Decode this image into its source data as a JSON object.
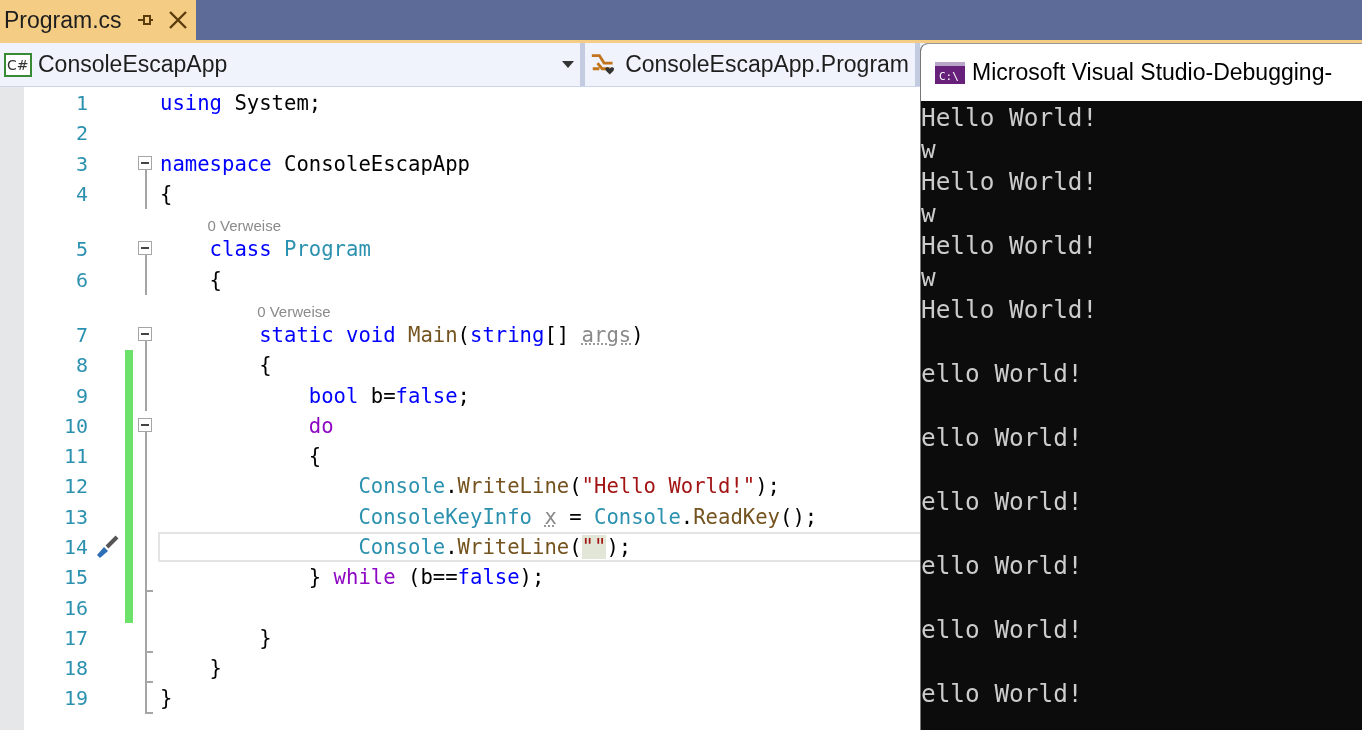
{
  "tab": {
    "title": "Program.cs",
    "active": true
  },
  "navbar": {
    "icon_label": "C#",
    "project": "ConsoleEscapApp",
    "type": "ConsoleEscapApp.Program"
  },
  "editor": {
    "lines": [
      {
        "number": "1",
        "collapsible": false,
        "in_block": false,
        "block_end": false,
        "changed": false,
        "current": false,
        "tokens": [
          {
            "text": "using ",
            "kind": "kw"
          },
          {
            "text": "System;",
            "kind": "plain"
          }
        ]
      },
      {
        "number": "2",
        "collapsible": false,
        "in_block": false,
        "block_end": false,
        "changed": false,
        "current": false
      },
      {
        "number": "3",
        "collapsible": true,
        "in_block": true,
        "block_end": false,
        "changed": false,
        "current": false,
        "tokens": [
          {
            "text": "namespace ",
            "kind": "kw"
          },
          {
            "text": "ConsoleEscapApp",
            "kind": "plain"
          }
        ]
      },
      {
        "number": "4",
        "collapsible": false,
        "in_block": true,
        "block_end": false,
        "changed": false,
        "current": false,
        "tokens": [
          {
            "text": "{",
            "kind": "plain"
          }
        ],
        "children": [
          {
            "number": "5",
            "collapsible": true,
            "in_block": true,
            "block_end": false,
            "changed": false,
            "current": false,
            "codelens": "0 Verweise",
            "tokens": [
              {
                "text": "class ",
                "kind": "kw"
              },
              {
                "text": "Program",
                "kind": "type"
              }
            ]
          },
          {
            "number": "6",
            "collapsible": false,
            "in_block": true,
            "block_end": false,
            "changed": false,
            "current": false,
            "tokens": [
              {
                "text": "{",
                "kind": "plain"
              }
            ],
            "children": [
              {
                "number": "7",
                "collapsible": true,
                "in_block": true,
                "block_end": false,
                "changed": false,
                "current": false,
                "codelens": "0 Verweise",
                "tokens": [
                  {
                    "text": "static ",
                    "kind": "kw"
                  },
                  {
                    "text": "void ",
                    "kind": "kw"
                  },
                  {
                    "text": "Main",
                    "kind": "method"
                  },
                  {
                    "text": "(",
                    "kind": "plain"
                  },
                  {
                    "text": "string",
                    "kind": "kw"
                  },
                  {
                    "text": "[] ",
                    "kind": "plain"
                  },
                  {
                    "text": "args",
                    "kind": "unused"
                  },
                  {
                    "text": ")",
                    "kind": "plain"
                  }
                ]
              },
              {
                "number": "8",
                "collapsible": false,
                "in_block": true,
                "block_end": false,
                "changed": true,
                "current": false,
                "tokens": [
                  {
                    "text": "{",
                    "kind": "plain"
                  }
                ],
                "children": [
                  {
                    "number": "9",
                    "collapsible": false,
                    "in_block": true,
                    "block_end": false,
                    "changed": true,
                    "current": false,
                    "tokens": [
                      {
                        "text": "bool ",
                        "kind": "kw"
                      },
                      {
                        "text": "b=",
                        "kind": "plain"
                      },
                      {
                        "text": "false",
                        "kind": "kw"
                      },
                      {
                        "text": ";",
                        "kind": "plain"
                      }
                    ]
                  },
                  {
                    "number": "10",
                    "collapsible": true,
                    "in_block": true,
                    "block_end": false,
                    "changed": true,
                    "current": false,
                    "tokens": [
                      {
                        "text": "do",
                        "kind": "ctl"
                      }
                    ]
                  },
                  {
                    "number": "11",
                    "collapsible": false,
                    "in_block": true,
                    "block_end": false,
                    "changed": true,
                    "current": false,
                    "tokens": [
                      {
                        "text": "{",
                        "kind": "plain"
                      }
                    ],
                    "children": [
                      {
                        "number": "12",
                        "collapsible": false,
                        "in_block": true,
                        "block_end": false,
                        "changed": true,
                        "current": false,
                        "tokens": [
                          {
                            "text": "Console",
                            "kind": "type"
                          },
                          {
                            "text": ".",
                            "kind": "plain"
                          },
                          {
                            "text": "WriteLine",
                            "kind": "method"
                          },
                          {
                            "text": "(",
                            "kind": "plain"
                          },
                          {
                            "text": "\"Hello World!\"",
                            "kind": "str"
                          },
                          {
                            "text": ");",
                            "kind": "plain"
                          }
                        ]
                      },
                      {
                        "number": "13",
                        "collapsible": false,
                        "in_block": true,
                        "block_end": false,
                        "changed": true,
                        "current": false,
                        "tokens": [
                          {
                            "text": "ConsoleKeyInfo ",
                            "kind": "type"
                          },
                          {
                            "text": "x",
                            "kind": "unused"
                          },
                          {
                            "text": " = ",
                            "kind": "plain"
                          },
                          {
                            "text": "Console",
                            "kind": "type"
                          },
                          {
                            "text": ".",
                            "kind": "plain"
                          },
                          {
                            "text": "ReadKey",
                            "kind": "method"
                          },
                          {
                            "text": "();",
                            "kind": "plain"
                          }
                        ]
                      },
                      {
                        "number": "14",
                        "collapsible": false,
                        "in_block": true,
                        "block_end": false,
                        "changed": true,
                        "current": true,
                        "quick_action": true,
                        "tokens": [
                          {
                            "text": "Console",
                            "kind": "type"
                          },
                          {
                            "text": ".",
                            "kind": "plain"
                          },
                          {
                            "text": "WriteLine",
                            "kind": "method"
                          },
                          {
                            "text": "(",
                            "kind": "plain"
                          },
                          {
                            "text": "\"\"",
                            "kind": "str",
                            "highlight": true
                          },
                          {
                            "text": ");",
                            "kind": "plain"
                          }
                        ]
                      }
                    ]
                  },
                  {
                    "number": "15",
                    "collapsible": false,
                    "in_block": true,
                    "block_end": true,
                    "changed": true,
                    "current": false,
                    "tokens": [
                      {
                        "text": "} ",
                        "kind": "plain"
                      },
                      {
                        "text": "while",
                        "kind": "ctl"
                      },
                      {
                        "text": " (b==",
                        "kind": "plain"
                      },
                      {
                        "text": "false",
                        "kind": "kw"
                      },
                      {
                        "text": ");",
                        "kind": "plain"
                      }
                    ]
                  },
                  {
                    "number": "16",
                    "collapsible": false,
                    "in_block": true,
                    "block_end": false,
                    "changed": true,
                    "current": false
                  }
                ]
              },
              {
                "number": "17",
                "collapsible": false,
                "in_block": true,
                "block_end": true,
                "changed": false,
                "current": false,
                "tokens": [
                  {
                    "text": "}",
                    "kind": "plain"
                  }
                ]
              }
            ]
          },
          {
            "number": "18",
            "collapsible": false,
            "in_block": true,
            "block_end": true,
            "changed": false,
            "current": false,
            "tokens": [
              {
                "text": "}",
                "kind": "plain"
              }
            ]
          }
        ]
      },
      {
        "number": "19",
        "collapsible": false,
        "in_block": true,
        "block_end": true,
        "changed": false,
        "current": false,
        "tokens": [
          {
            "text": "}",
            "kind": "plain"
          }
        ]
      }
    ]
  },
  "console": {
    "icon_label": "C:\\",
    "title": "Microsoft Visual Studio-Debugging-",
    "output": [
      {
        "text": "Hello World!",
        "gap_before": false
      },
      {
        "text": "w",
        "gap_before": false
      },
      {
        "text": "Hello World!",
        "gap_before": false
      },
      {
        "text": "w",
        "gap_before": false
      },
      {
        "text": "Hello World!",
        "gap_before": false
      },
      {
        "text": "w",
        "gap_before": false
      },
      {
        "text": "Hello World!",
        "gap_before": false
      },
      {
        "text": "ello World!",
        "gap_before": true
      },
      {
        "text": "ello World!",
        "gap_before": true
      },
      {
        "text": "ello World!",
        "gap_before": true
      },
      {
        "text": "ello World!",
        "gap_before": true
      },
      {
        "text": "ello World!",
        "gap_before": true
      },
      {
        "text": "ello World!",
        "gap_before": true
      }
    ]
  }
}
